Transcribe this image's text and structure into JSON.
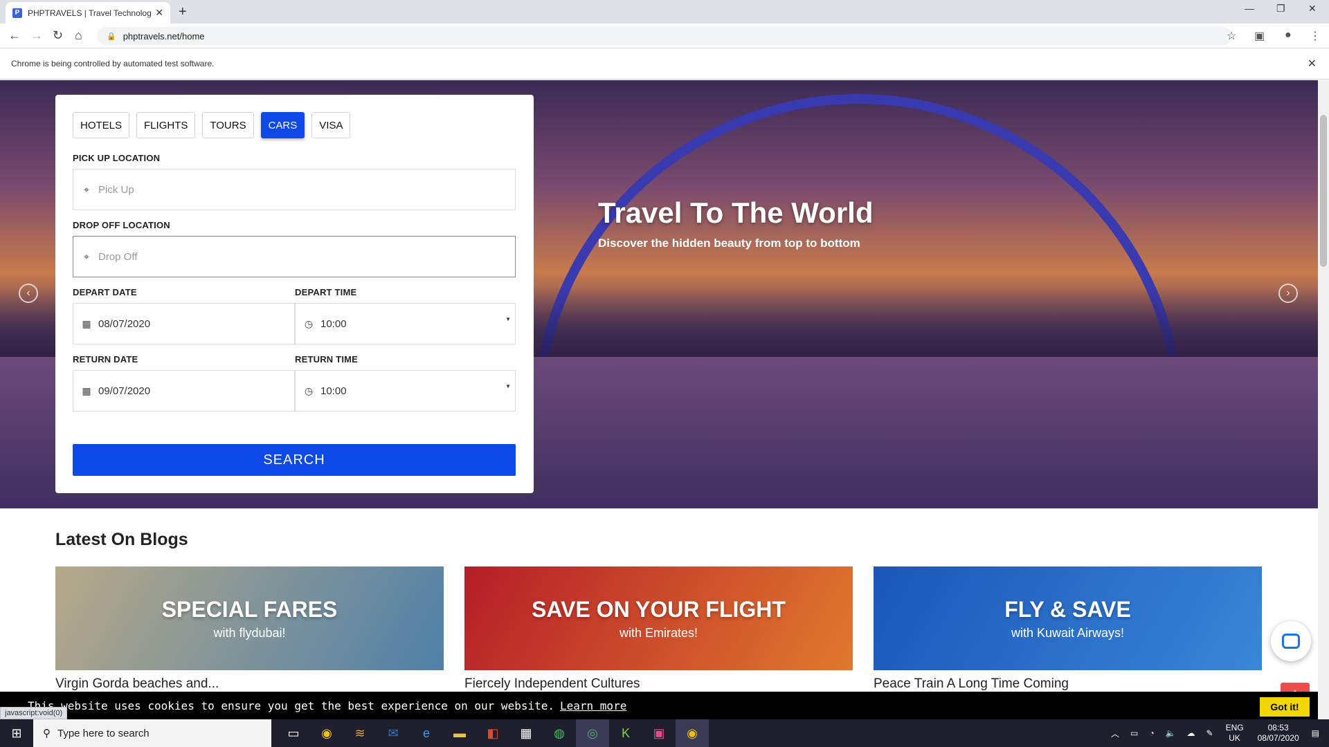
{
  "browser": {
    "tab_title": "PHPTRAVELS | Travel Technology",
    "tab_close": "✕",
    "new_tab": "+",
    "url": "phptravels.net/home",
    "infobar_text": "Chrome is being controlled by automated test software.",
    "status_text": "javascript:void(0)"
  },
  "hero": {
    "title": "Travel To The World",
    "subtitle": "Discover the hidden beauty from top to bottom"
  },
  "search": {
    "tabs": [
      {
        "label": "HOTELS",
        "active": false
      },
      {
        "label": "FLIGHTS",
        "active": false
      },
      {
        "label": "TOURS",
        "active": false
      },
      {
        "label": "CARS",
        "active": true
      },
      {
        "label": "VISA",
        "active": false
      }
    ],
    "pickup_label": "PICK UP LOCATION",
    "pickup_placeholder": "Pick Up",
    "dropoff_label": "DROP OFF LOCATION",
    "dropoff_placeholder": "Drop Off",
    "depart_date_label": "DEPART DATE",
    "depart_date_value": "08/07/2020",
    "depart_time_label": "DEPART TIME",
    "depart_time_value": "10:00",
    "return_date_label": "RETURN DATE",
    "return_date_value": "09/07/2020",
    "return_time_label": "RETURN TIME",
    "return_time_value": "10:00",
    "search_button": "SEARCH"
  },
  "blogs": {
    "heading": "Latest On Blogs",
    "cards": [
      {
        "banner_big": "SPECIAL FARES",
        "banner_small": "with flydubai!",
        "title": "Virgin Gorda beaches and...",
        "color_a": "#b7a98a",
        "color_b": "#4f80a8"
      },
      {
        "banner_big": "SAVE ON YOUR FLIGHT",
        "banner_small": "with Emirates!",
        "title": "Fiercely Independent Cultures",
        "color_a": "#b51d28",
        "color_b": "#e07a2e"
      },
      {
        "banner_big": "FLY & SAVE",
        "banner_small": "with Kuwait Airways!",
        "title": "Peace Train A Long Time Coming",
        "color_a": "#1a56b8",
        "color_b": "#3a86d8"
      }
    ]
  },
  "cookie": {
    "text": "This website uses cookies to ensure you get the best experience on our website.",
    "link": "Learn more",
    "button": "Got it!"
  },
  "taskbar": {
    "search_placeholder": "Type here to search",
    "lang": "ENG",
    "region": "UK",
    "time": "08:53",
    "date": "08/07/2020"
  }
}
